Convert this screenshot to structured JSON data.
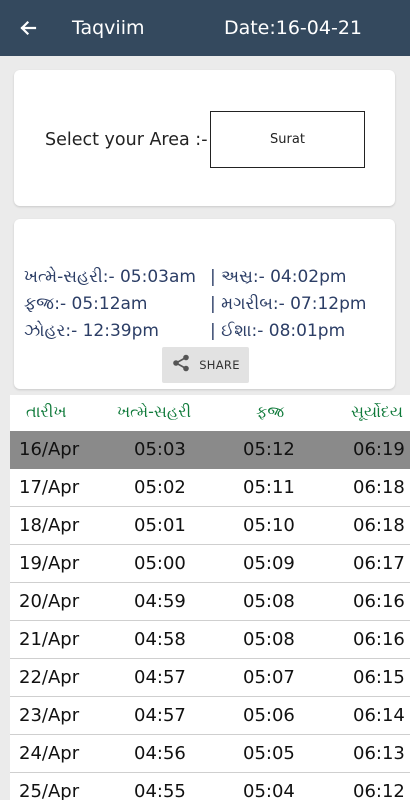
{
  "appbar": {
    "title": "Taqviim",
    "date": "Date:16-04-21"
  },
  "area": {
    "label": "Select your Area :-",
    "value": "Surat"
  },
  "times": {
    "sehri": "ખત્મે-સહરી:- 05:03am",
    "asr": "| અસ્ર:- 04:02pm",
    "fajr": "ફજ્ર:- 05:12am",
    "maghrib": "| મગરીબ:- 07:12pm",
    "zohar": "ઝોહર:- 12:39pm",
    "isha": "| ઈશા:- 08:01pm"
  },
  "share": {
    "label": "SHARE"
  },
  "table": {
    "headers": [
      "તારીખ",
      "ખત્મે-સહરી",
      "ફજ્ર",
      "સૂર્યોદય"
    ],
    "rows": [
      [
        "16/Apr",
        "05:03",
        "05:12",
        "06:19"
      ],
      [
        "17/Apr",
        "05:02",
        "05:11",
        "06:18"
      ],
      [
        "18/Apr",
        "05:01",
        "05:10",
        "06:18"
      ],
      [
        "19/Apr",
        "05:00",
        "05:09",
        "06:17"
      ],
      [
        "20/Apr",
        "04:59",
        "05:08",
        "06:16"
      ],
      [
        "21/Apr",
        "04:58",
        "05:08",
        "06:16"
      ],
      [
        "22/Apr",
        "04:57",
        "05:07",
        "06:15"
      ],
      [
        "23/Apr",
        "04:57",
        "05:06",
        "06:14"
      ],
      [
        "24/Apr",
        "04:56",
        "05:05",
        "06:13"
      ],
      [
        "25/Apr",
        "04:55",
        "05:04",
        "06:12"
      ]
    ],
    "selected_row": 0
  },
  "icons": {
    "back": "arrow-left-icon",
    "share": "share-icon"
  },
  "colors": {
    "appbar": "#34495e",
    "header_text": "#0f7a3a",
    "times_text": "#2c3e66",
    "selected_row": "#8a8a8a"
  }
}
